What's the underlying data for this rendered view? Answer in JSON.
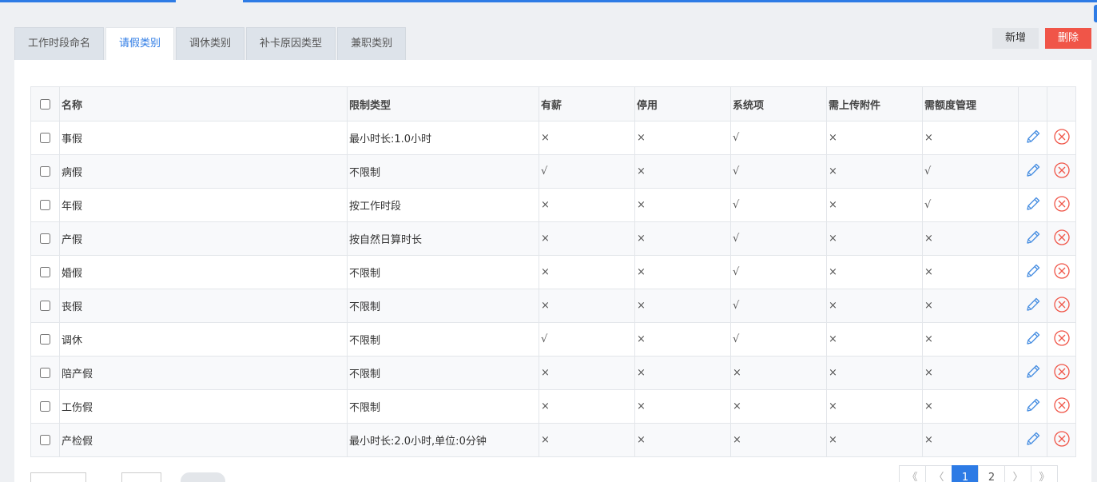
{
  "tabs": [
    {
      "label": "工作时段命名",
      "active": false
    },
    {
      "label": "请假类别",
      "active": true
    },
    {
      "label": "调休类别",
      "active": false
    },
    {
      "label": "补卡原因类型",
      "active": false
    },
    {
      "label": "兼职类别",
      "active": false
    }
  ],
  "actions": {
    "add_label": "新增",
    "delete_label": "删除"
  },
  "table": {
    "headers": {
      "name": "名称",
      "limit": "限制类型",
      "paid": "有薪",
      "disabled": "停用",
      "system": "系统项",
      "attach": "需上传附件",
      "quota": "需额度管理"
    },
    "rows": [
      {
        "name": "事假",
        "limit": "最小时长:1.0小时",
        "paid": "×",
        "disabled": "×",
        "system": "√",
        "attach": "×",
        "quota": "×"
      },
      {
        "name": "病假",
        "limit": "不限制",
        "paid": "√",
        "disabled": "×",
        "system": "√",
        "attach": "×",
        "quota": "√"
      },
      {
        "name": "年假",
        "limit": "按工作时段",
        "paid": "×",
        "disabled": "×",
        "system": "√",
        "attach": "×",
        "quota": "√"
      },
      {
        "name": "产假",
        "limit": "按自然日算时长",
        "paid": "×",
        "disabled": "×",
        "system": "√",
        "attach": "×",
        "quota": "×"
      },
      {
        "name": "婚假",
        "limit": "不限制",
        "paid": "×",
        "disabled": "×",
        "system": "√",
        "attach": "×",
        "quota": "×"
      },
      {
        "name": "丧假",
        "limit": "不限制",
        "paid": "×",
        "disabled": "×",
        "system": "√",
        "attach": "×",
        "quota": "×"
      },
      {
        "name": "调休",
        "limit": "不限制",
        "paid": "√",
        "disabled": "×",
        "system": "√",
        "attach": "×",
        "quota": "×"
      },
      {
        "name": "陪产假",
        "limit": "不限制",
        "paid": "×",
        "disabled": "×",
        "system": "×",
        "attach": "×",
        "quota": "×"
      },
      {
        "name": "工伤假",
        "limit": "不限制",
        "paid": "×",
        "disabled": "×",
        "system": "×",
        "attach": "×",
        "quota": "×"
      },
      {
        "name": "产检假",
        "limit": "最小时长:2.0小时,单位:0分钟",
        "paid": "×",
        "disabled": "×",
        "system": "×",
        "attach": "×",
        "quota": "×"
      }
    ]
  },
  "pagination": {
    "first": "《",
    "prev": "〈",
    "pages": [
      "1",
      "2"
    ],
    "next": "〉",
    "last": "》",
    "current": "1"
  },
  "colors": {
    "accent": "#2d7be5",
    "danger": "#f05548",
    "edit_icon": "#4a90e2"
  },
  "icons": {
    "edit": "pencil-icon",
    "delete": "circle-x-icon"
  }
}
